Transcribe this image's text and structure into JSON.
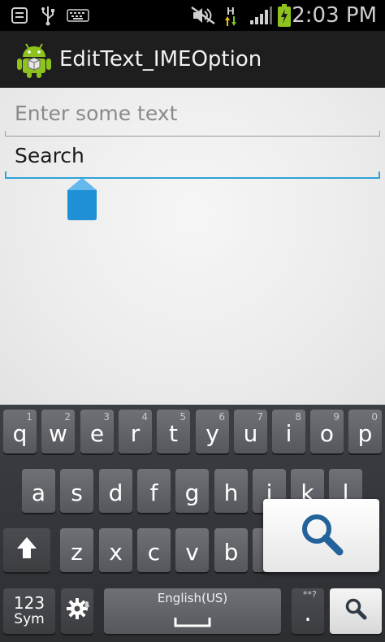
{
  "status_bar": {
    "time": "2:03 PM",
    "icons": [
      "notification-list-icon",
      "usb-icon",
      "keyboard-icon",
      "mute-icon",
      "h-data-icon",
      "signal-icon",
      "battery-charging-icon"
    ],
    "network_label": "H"
  },
  "action_bar": {
    "title": "EditText_IMEOption",
    "app_icon": "android-icon"
  },
  "form": {
    "field1_placeholder": "Enter some text",
    "field2_value": "Search"
  },
  "keyboard": {
    "row1": [
      {
        "label": "q",
        "num": "1"
      },
      {
        "label": "w",
        "num": "2"
      },
      {
        "label": "e",
        "num": "3"
      },
      {
        "label": "r",
        "num": "4"
      },
      {
        "label": "t",
        "num": "5"
      },
      {
        "label": "y",
        "num": "6"
      },
      {
        "label": "u",
        "num": "7"
      },
      {
        "label": "i",
        "num": "8"
      },
      {
        "label": "o",
        "num": "9"
      },
      {
        "label": "p",
        "num": "0"
      }
    ],
    "row2": [
      "a",
      "s",
      "d",
      "f",
      "g",
      "h",
      "j",
      "k",
      "l"
    ],
    "row3": [
      "z",
      "x",
      "c",
      "v",
      "b"
    ],
    "sym_top": "123",
    "sym_bottom": "Sym",
    "space_label": "English(US)",
    "period_label": ".",
    "period_hint": "**?",
    "action_icon": "search-icon",
    "accent_color": "#2fa3d6"
  }
}
